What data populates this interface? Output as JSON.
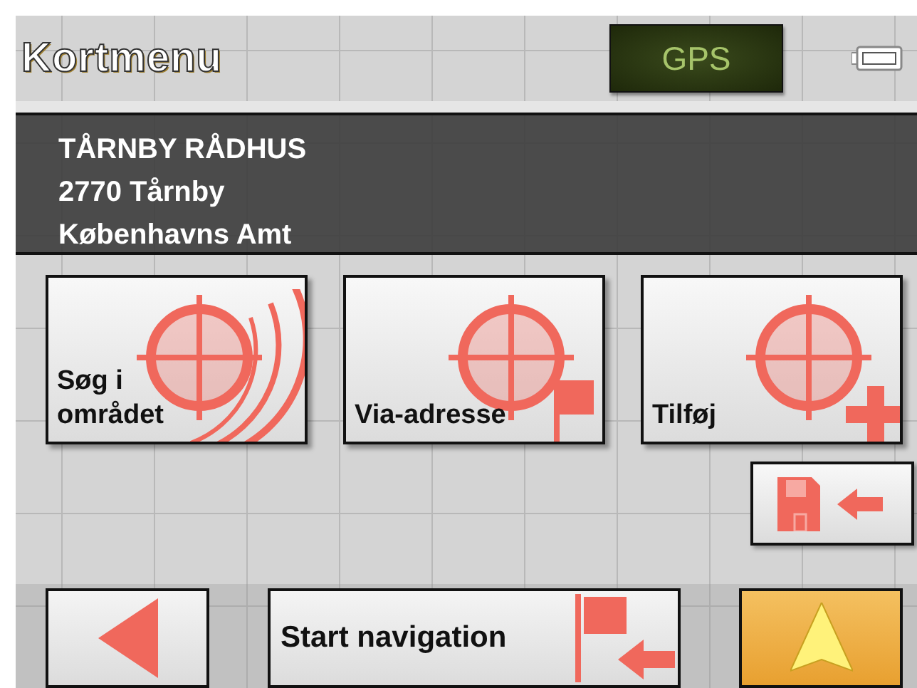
{
  "header": {
    "title": "Kortmenu",
    "gps": "GPS"
  },
  "address": [
    "TÅRNBY RÅDHUS",
    "2770 Tårnby",
    "Københavns Amt"
  ],
  "actions": [
    {
      "kind": "search-area",
      "label": "Søg i\nområdet"
    },
    {
      "kind": "via",
      "label": "Via-adresse"
    },
    {
      "kind": "add",
      "label": "Tilføj"
    }
  ],
  "bottom": {
    "start_label": "Start navigation"
  }
}
